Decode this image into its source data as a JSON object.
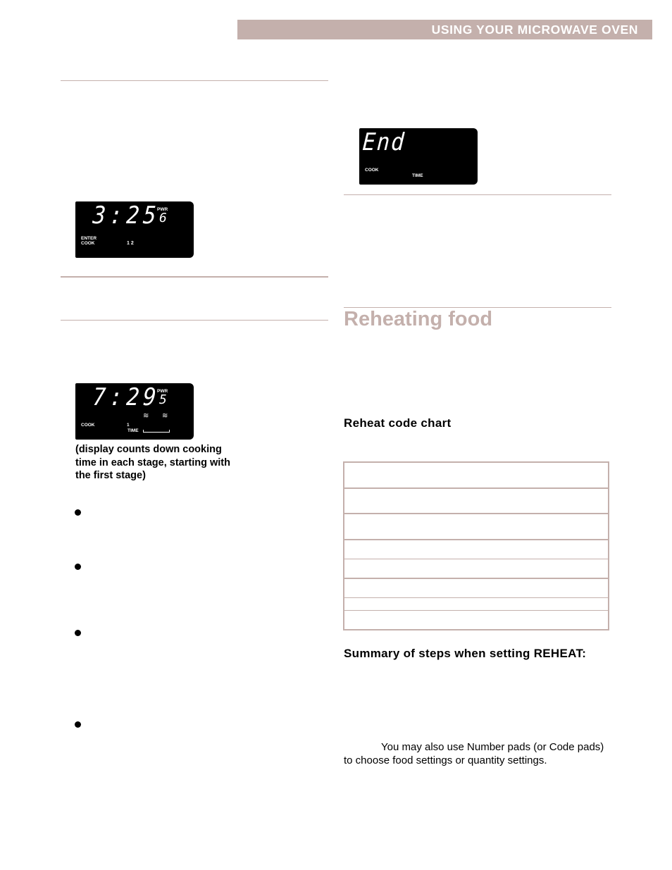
{
  "header": {
    "title": "USING YOUR MICROWAVE OVEN"
  },
  "colors": {
    "accent": "#c4b0ac",
    "display_bg": "#000000",
    "display_text": "#ffffff"
  },
  "displays": [
    {
      "time": "3:25",
      "power_label": "PWR",
      "power_value": "6",
      "labels": [
        "ENTER",
        "COOK"
      ],
      "stages": "1 2"
    },
    {
      "time": "7:29",
      "power_label": "PWR",
      "power_value": "5",
      "labels": [
        "COOK"
      ],
      "stage": "1",
      "time_label": "TIME",
      "wave_icon": "≋"
    },
    {
      "time": "End",
      "labels": [
        "COOK"
      ],
      "time_label": "TIME"
    }
  ],
  "left_column": {
    "caption": "(display counts down cooking time in each stage, starting with the first stage)",
    "bullet_count": 4
  },
  "right_column": {
    "section_title": "Reheating food",
    "chart_heading": "Reheat code chart",
    "chart_rows": 8,
    "summary_heading": "Summary of steps when setting REHEAT:",
    "note": "You may also use Number pads (or Code pads) to choose food settings or quantity settings."
  }
}
